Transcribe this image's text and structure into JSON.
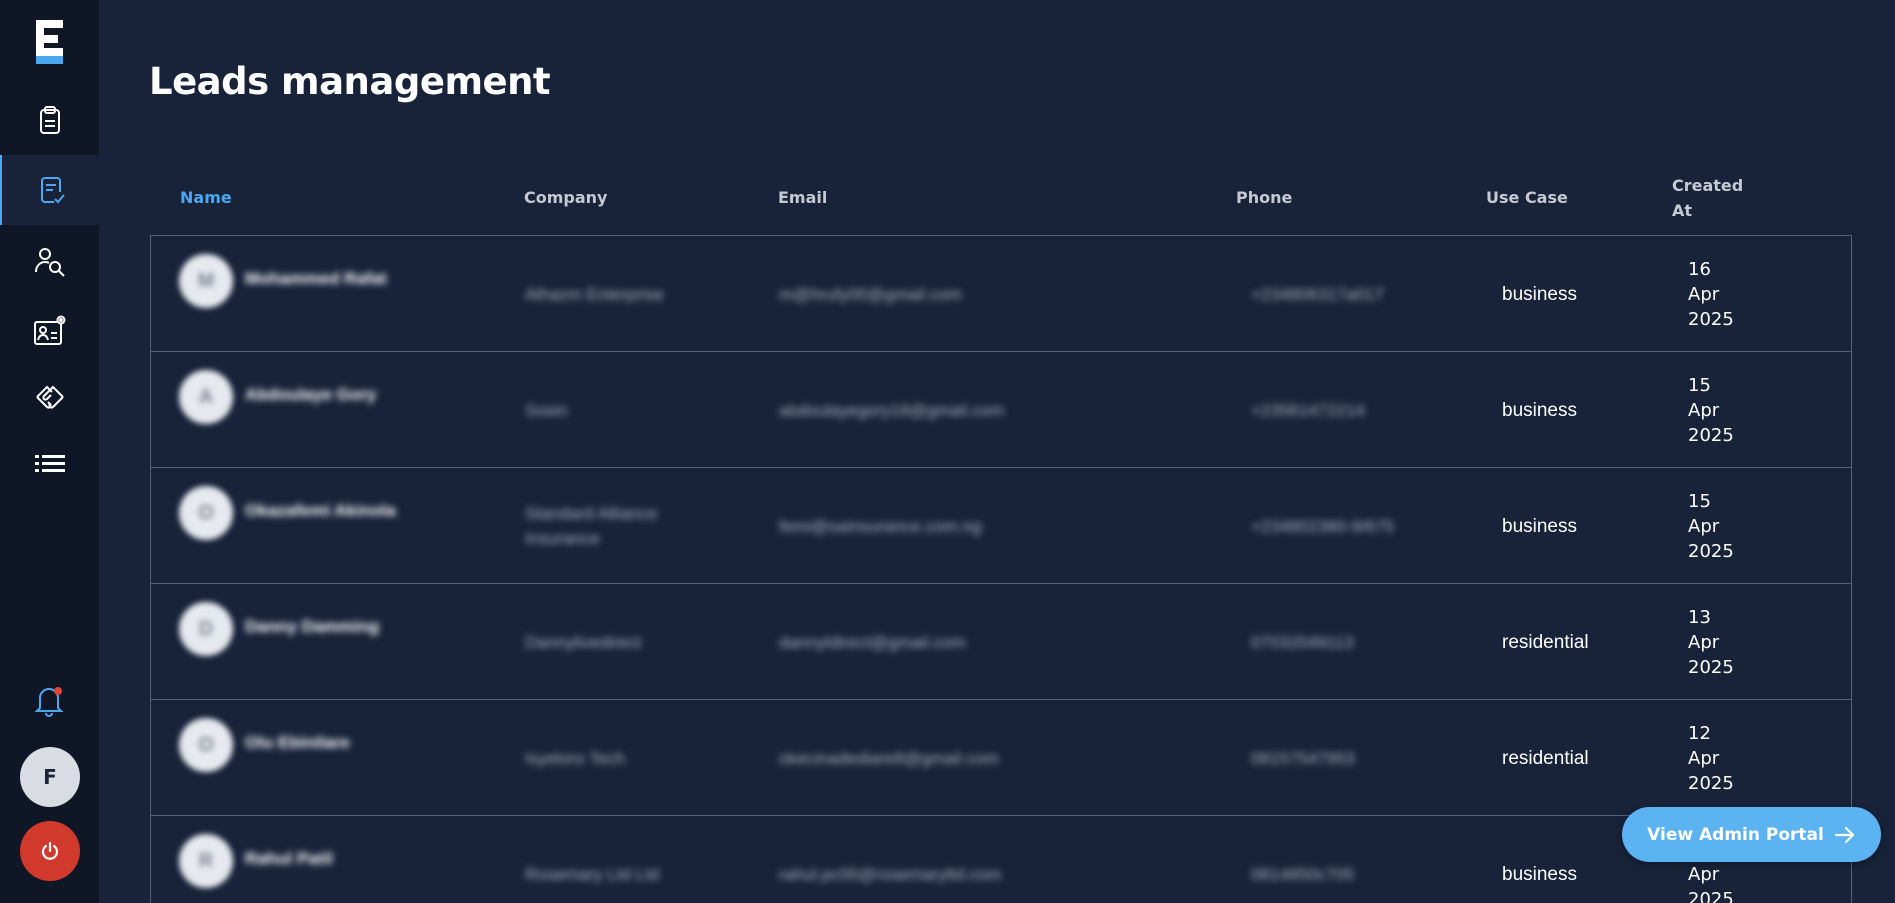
{
  "brand": {
    "logo_letter": "F",
    "accent": "#4aa8f0"
  },
  "sidebar": {
    "items": [
      {
        "icon": "clipboard-icon"
      },
      {
        "icon": "clipboard-check-icon",
        "active": true
      },
      {
        "icon": "user-search-icon"
      },
      {
        "icon": "profile-settings-icon"
      },
      {
        "icon": "handshake-icon"
      },
      {
        "icon": "list-icon"
      }
    ],
    "notification_icon": "bell-icon",
    "user_initial": "F",
    "logout_icon": "power-icon"
  },
  "page": {
    "title": "Leads management"
  },
  "table": {
    "columns": [
      "Name",
      "Company",
      "Email",
      "Phone",
      "Use Case",
      "Created At"
    ],
    "sorted_column": "Name",
    "rows": [
      {
        "avatar": "M",
        "name": "Mohammed Rafat",
        "company": "Alhazm Enterprise",
        "email": "m@hrufy00@gmail.com",
        "phone": "+234806317a017",
        "use_case": "business",
        "created_at": "16\nApr\n2025"
      },
      {
        "avatar": "A",
        "name": "Abdoulaye Gory",
        "company": "Sosin",
        "email": "abdoulayegory18@gmail.com",
        "phone": "+23561472214",
        "use_case": "business",
        "created_at": "15\nApr\n2025"
      },
      {
        "avatar": "O",
        "name": "Okazafemi Akinola",
        "company": "Standard Alliance Insurance",
        "email": "femi@saInsurance.com.ng",
        "phone": "+234802380-9/675",
        "use_case": "business",
        "created_at": "15\nApr\n2025"
      },
      {
        "avatar": "D",
        "name": "Danny Damming",
        "company": "Dannylivedirect",
        "email": "dannyldirect@gmail.com",
        "phone": "07032049113",
        "use_case": "residential",
        "created_at": "13\nApr\n2025"
      },
      {
        "avatar": "O",
        "name": "Olu Ebinilare",
        "company": "Isyeloro Tech",
        "email": "okecinadediare8@gmail.com",
        "phone": "08157547953",
        "use_case": "residential",
        "created_at": "12\nApr\n2025"
      },
      {
        "avatar": "R",
        "name": "Rahul Patil",
        "company": "Rosemary Ltd Ltd",
        "email": "rahul.pc00@rosemaryltd.com",
        "phone": "0814850c705",
        "use_case": "business",
        "created_at": "\nApr\n2025"
      }
    ]
  },
  "cta": {
    "label": "View Admin Portal",
    "icon": "arrow-right-icon"
  }
}
